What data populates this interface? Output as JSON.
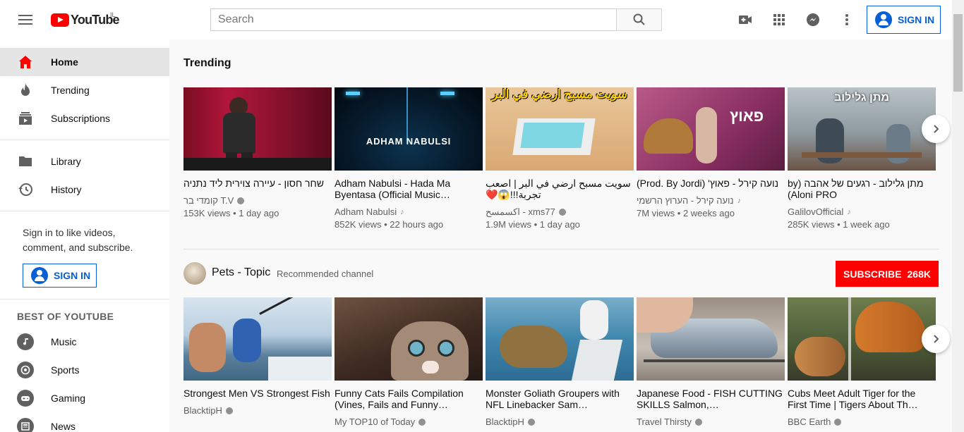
{
  "header": {
    "logo_text": "YouTube",
    "country_code": "IL",
    "search_placeholder": "Search",
    "sign_in_label": "SIGN IN"
  },
  "sidebar": {
    "main_items": [
      {
        "label": "Home",
        "icon": "home-icon"
      },
      {
        "label": "Trending",
        "icon": "flame-icon"
      },
      {
        "label": "Subscriptions",
        "icon": "subscriptions-icon"
      }
    ],
    "library_items": [
      {
        "label": "Library",
        "icon": "folder-icon"
      },
      {
        "label": "History",
        "icon": "history-icon"
      }
    ],
    "signin_prompt": "Sign in to like videos, comment, and subscribe.",
    "signin_label": "SIGN IN",
    "best_heading": "BEST OF YOUTUBE",
    "best_items": [
      {
        "label": "Music",
        "icon": "music-icon"
      },
      {
        "label": "Sports",
        "icon": "sports-icon"
      },
      {
        "label": "Gaming",
        "icon": "gaming-icon"
      },
      {
        "label": "News",
        "icon": "news-icon"
      }
    ]
  },
  "trending": {
    "title": "Trending",
    "videos": [
      {
        "title": "שחר חסון - עיירה צוירית ליד נתניה",
        "channel": "קומדי בר T.V",
        "badge": "verified",
        "stats": "153K views • 1 day ago"
      },
      {
        "title": "Adham Nabulsi - Hada Ma Byentasa (Official Music…",
        "channel": "Adham Nabulsi",
        "badge": "music",
        "stats": "852K views • 22 hours ago"
      },
      {
        "title": "سويت مسبح ارضي في البر | اصعب تجربة!!!😱❤️",
        "channel": "اكسمسح - xms77",
        "badge": "verified",
        "stats": "1.9M views • 1 day ago"
      },
      {
        "title": "נועה קירל - פאוץ' (Prod. By Jordi)",
        "channel": "נועה קירל - הערוץ הרשמי",
        "badge": "music",
        "stats": "7M views • 2 weeks ago"
      },
      {
        "title": "מתן גלילוב - רגעים של אהבה (by Aloni PRO)",
        "channel": "GalilovOfficial",
        "badge": "music",
        "stats": "285K views • 1 week ago"
      }
    ],
    "thumb_texts": [
      "",
      "ADHAM NABULSI",
      "سويت مسبح ارضي في البر",
      "פאוץ",
      "מתן גלילוב"
    ]
  },
  "pets": {
    "channel_name": "Pets - Topic",
    "channel_sub": "Recommended channel",
    "subscribe_label": "SUBSCRIBE",
    "subscriber_count": "268K",
    "videos": [
      {
        "title": "Strongest Men VS Strongest Fish",
        "channel": "BlacktipH"
      },
      {
        "title": "Funny Cats Fails Compilation (Vines, Fails and Funny…",
        "channel": "My TOP10 of Today"
      },
      {
        "title": "Monster Goliath Groupers with NFL Linebacker Sam…",
        "channel": "BlacktipH"
      },
      {
        "title": "Japanese Food - FISH CUTTING SKILLS Salmon,…",
        "channel": "Travel Thirsty"
      },
      {
        "title": "Cubs Meet Adult Tiger for the First Time | Tigers About Th…",
        "channel": "BBC Earth"
      }
    ]
  },
  "colors": {
    "brand_red": "#ff0000",
    "link_blue": "#065fd4"
  }
}
